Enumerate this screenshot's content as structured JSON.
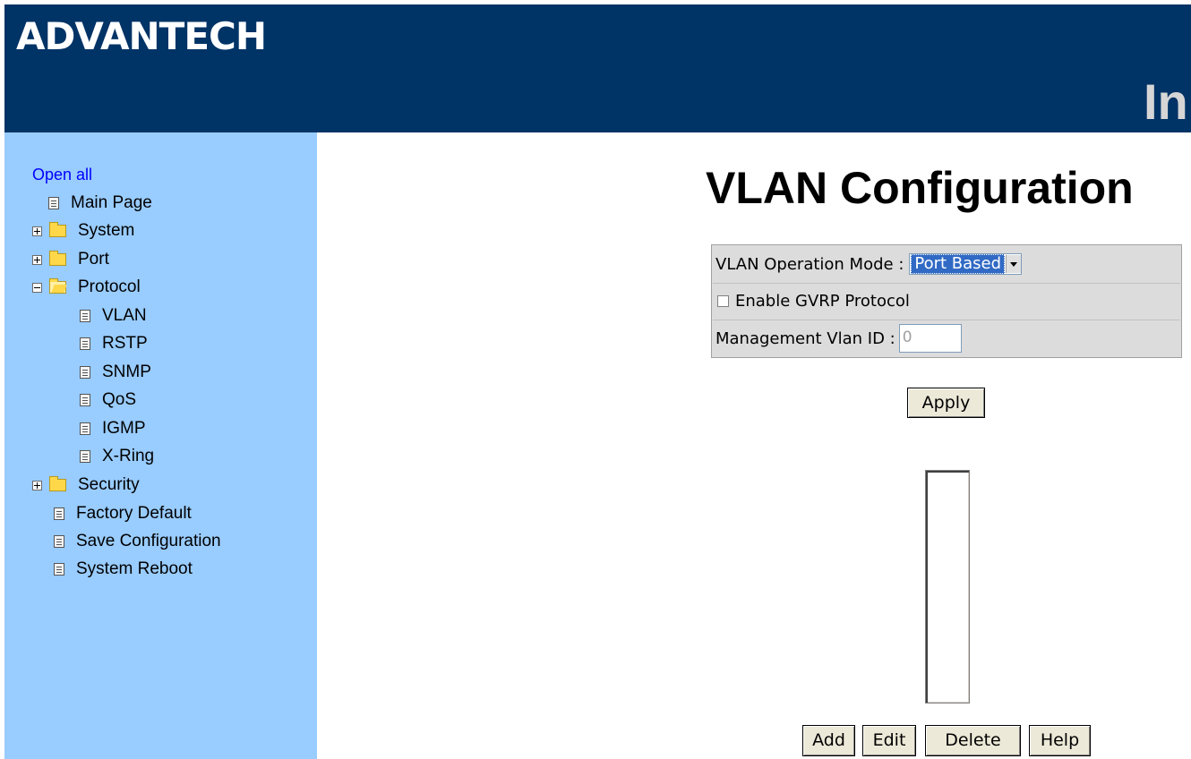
{
  "header": {
    "logo_text": "ADVANTECH",
    "title_partial": "In"
  },
  "sidebar": {
    "open_all": "Open all",
    "items": [
      {
        "label": "Main Page",
        "icon": "page-icon"
      },
      {
        "label": "System",
        "icon": "folder-icon",
        "expander": "plus"
      },
      {
        "label": "Port",
        "icon": "folder-icon",
        "expander": "plus"
      },
      {
        "label": "Protocol",
        "icon": "folder-open-icon",
        "expander": "minus"
      },
      {
        "label": "VLAN",
        "icon": "page-icon"
      },
      {
        "label": "RSTP",
        "icon": "page-icon"
      },
      {
        "label": "SNMP",
        "icon": "page-icon"
      },
      {
        "label": "QoS",
        "icon": "page-icon"
      },
      {
        "label": "IGMP",
        "icon": "page-icon"
      },
      {
        "label": "X-Ring",
        "icon": "page-icon"
      },
      {
        "label": "Security",
        "icon": "folder-icon",
        "expander": "plus"
      },
      {
        "label": "Factory Default",
        "icon": "page-icon"
      },
      {
        "label": "Save Configuration",
        "icon": "page-icon"
      },
      {
        "label": "System Reboot",
        "icon": "page-icon"
      }
    ]
  },
  "main": {
    "title": "VLAN Configuration",
    "operation_mode_label": "VLAN Operation Mode :",
    "operation_mode_value": "Port Based",
    "gvrp_label": "Enable GVRP Protocol",
    "gvrp_checked": false,
    "management_vlan_label": "Management Vlan ID :",
    "management_vlan_value": "0",
    "apply_label": "Apply",
    "add_label": "Add",
    "edit_label": "Edit",
    "delete_label": "Delete",
    "help_label": "Help"
  },
  "colors": {
    "header_bg": "#003366",
    "sidebar_bg": "#99ccff",
    "link": "#0000ff",
    "selection": "#316ac5",
    "button_face": "#ece9d8"
  }
}
